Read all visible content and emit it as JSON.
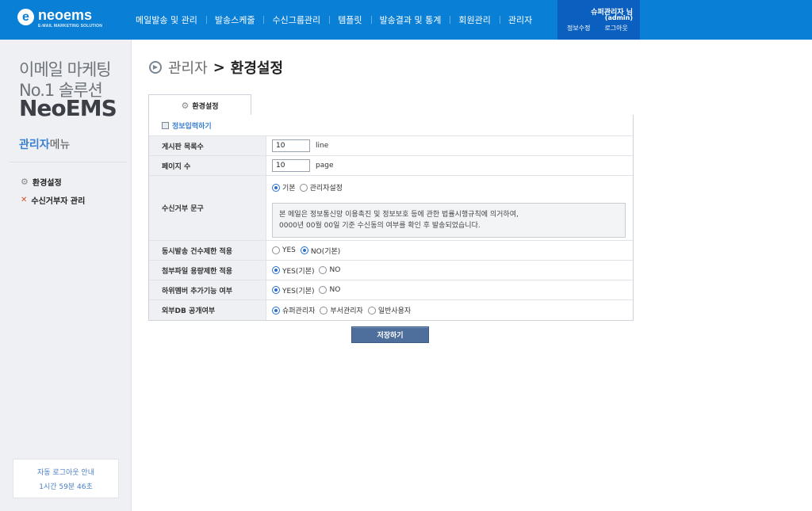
{
  "brand": {
    "mark": "e",
    "name": "neoems",
    "tagline": "E-MAIL MARKETING SOLUTION",
    "color": "#0a7fd6"
  },
  "nav": {
    "items": [
      "메일발송 및 관리",
      "발송스케줄",
      "수신그룹관리",
      "템플릿",
      "발송결과 및 통계",
      "회원관리",
      "관리자"
    ]
  },
  "user": {
    "name": "슈퍼관리자 님",
    "id": "(admin)",
    "edit_label": "정보수정",
    "logout_label": "로그아웃"
  },
  "sidebar": {
    "slogan_line1": "이메일 마케팅",
    "slogan_line2": "No.1 솔루션",
    "slogan_line3": "NeoEMS",
    "menu_title_accent": "관리자",
    "menu_title_rest": "메뉴",
    "items": [
      {
        "label": "환경설정",
        "icon": "gear-icon"
      },
      {
        "label": "수신거부자 관리",
        "icon": "x-icon"
      }
    ],
    "auto_logout_title": "자동 로그아웃 안내",
    "auto_logout_time": "1시간 59분 46초"
  },
  "page": {
    "breadcrumb": "관리자",
    "title": "환경설정"
  },
  "tab": {
    "label": "환경설정"
  },
  "form": {
    "section_label": "정보입력하기",
    "rows": [
      {
        "label": "게시판 목록수",
        "value": "10",
        "unit": "line"
      },
      {
        "label": "페이지 수",
        "value": "10",
        "unit": "page"
      },
      {
        "label": "수신거부 문구",
        "options": [
          "기본",
          "관리자설정"
        ],
        "selected": 0,
        "message_line1": "본 메일은 정보통신망 이용촉진 및 정보보호 등에 관한 법률시행규칙에 의거하여,",
        "message_line2": "0000년 00월 00일 기준 수신동의 여부를 확인 후 발송되었습니다."
      },
      {
        "label": "동시발송 건수제한 적용",
        "options": [
          "YES",
          "NO(기본)"
        ],
        "selected": 1
      },
      {
        "label": "첨부파일 용량제한 적용",
        "options": [
          "YES(기본)",
          "NO"
        ],
        "selected": 0
      },
      {
        "label": "하위멤버 추가기능 여부",
        "options": [
          "YES(기본)",
          "NO"
        ],
        "selected": 0
      },
      {
        "label": "외부DB 공개여부",
        "options": [
          "슈퍼관리자",
          "부서관리자",
          "일반사용자"
        ],
        "selected": 0
      }
    ],
    "save_label": "저장하기"
  }
}
